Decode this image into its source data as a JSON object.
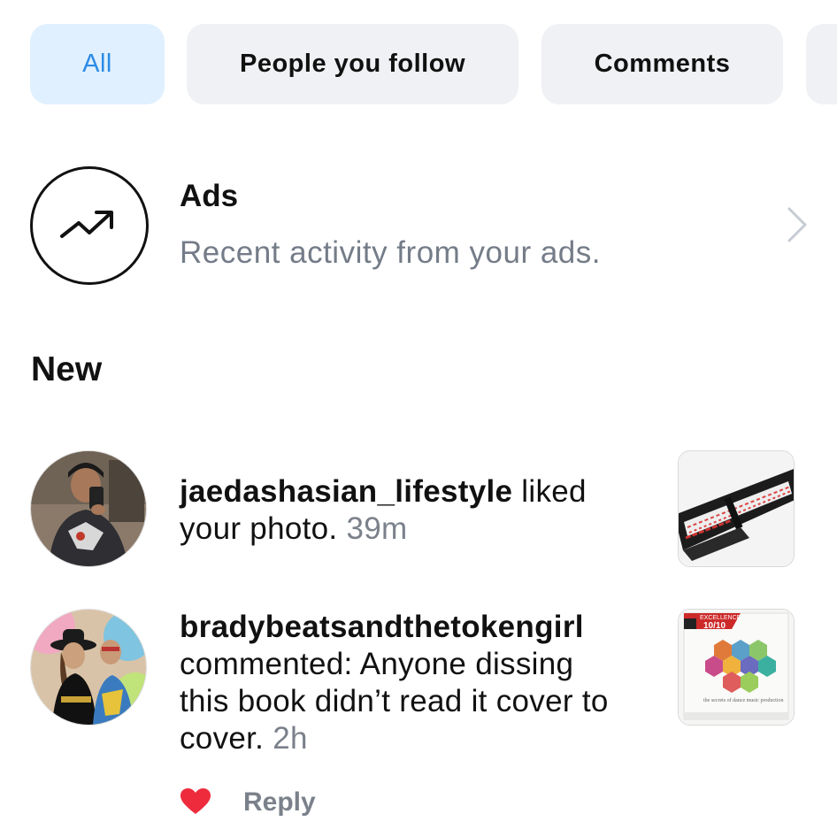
{
  "tabs": [
    {
      "label": "All",
      "active": true
    },
    {
      "label": "People you follow",
      "active": false
    },
    {
      "label": "Comments",
      "active": false
    },
    {
      "label": "",
      "active": false
    }
  ],
  "ads": {
    "icon": "trending-up-icon",
    "title": "Ads",
    "subtitle": "Recent activity from your ads."
  },
  "section_new": "New",
  "notifications": [
    {
      "username": "jaedashasian_lifestyle",
      "action": " liked your photo.",
      "time": "39m"
    },
    {
      "username": "bradybeatsandthetokengirl",
      "action": " commented: Anyone dissing this book didn’t read it cover to cover.",
      "time": "2h",
      "thumb_text": {
        "badge_top": "EXCELLENCE",
        "badge_rating": "10/10",
        "caption": "the secrets of dance music production"
      }
    }
  ],
  "comment_actions": {
    "like_icon": "heart-icon",
    "reply_label": "Reply"
  },
  "colors": {
    "active_tab_bg": "#e0f0fe",
    "active_tab_text": "#2b8be6",
    "muted_text": "#747c88",
    "heart": "#ed2b3c"
  }
}
